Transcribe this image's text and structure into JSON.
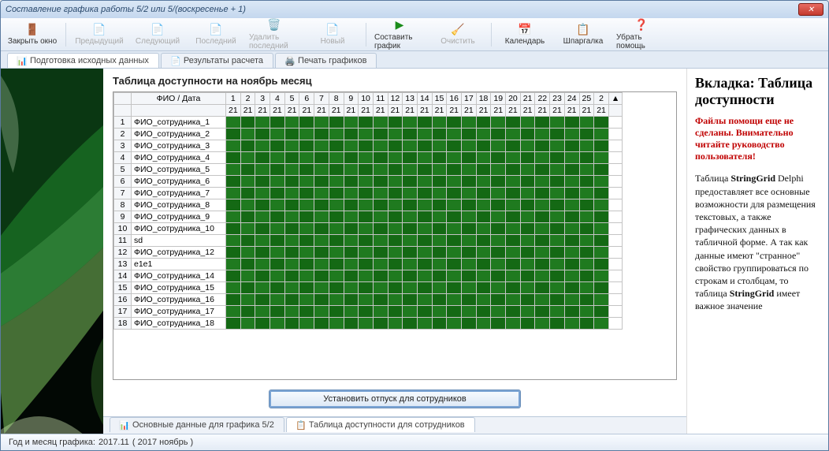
{
  "window": {
    "title": "Составление графика работы 5/2 или 5/(воскресенье + 1)"
  },
  "toolbar": {
    "close": "Закрыть окно",
    "prev": "Предыдущий",
    "next": "Следующий",
    "last": "Последний",
    "delLast": "Удалить последний",
    "new": "Новый",
    "compose": "Составить график",
    "clear": "Очистить",
    "calendar": "Календарь",
    "hint": "Шпаргалка",
    "hideHelp": "Убрать помощь"
  },
  "topTabs": {
    "prepare": "Подготовка исходных данных",
    "results": "Результаты расчета",
    "print": "Печать графиков"
  },
  "grid": {
    "title": "Таблица доступности на ноябрь месяц",
    "fioHeader": "ФИО / Дата",
    "days": [
      "1",
      "2",
      "3",
      "4",
      "5",
      "6",
      "7",
      "8",
      "9",
      "10",
      "11",
      "12",
      "13",
      "14",
      "15",
      "16",
      "17",
      "18",
      "19",
      "20",
      "21",
      "22",
      "23",
      "24",
      "25",
      "2"
    ],
    "fill": "21",
    "rows": [
      {
        "n": "1",
        "name": "ФИО_сотрудника_1"
      },
      {
        "n": "2",
        "name": "ФИО_сотрудника_2"
      },
      {
        "n": "3",
        "name": "ФИО_сотрудника_3"
      },
      {
        "n": "4",
        "name": "ФИО_сотрудника_4"
      },
      {
        "n": "5",
        "name": "ФИО_сотрудника_5"
      },
      {
        "n": "6",
        "name": "ФИО_сотрудника_6"
      },
      {
        "n": "7",
        "name": "ФИО_сотрудника_7"
      },
      {
        "n": "8",
        "name": "ФИО_сотрудника_8"
      },
      {
        "n": "9",
        "name": "ФИО_сотрудника_9"
      },
      {
        "n": "10",
        "name": "ФИО_сотрудника_10"
      },
      {
        "n": "11",
        "name": "sd"
      },
      {
        "n": "12",
        "name": "ФИО_сотрудника_12"
      },
      {
        "n": "13",
        "name": "e1e1"
      },
      {
        "n": "14",
        "name": "ФИО_сотрудника_14"
      },
      {
        "n": "15",
        "name": "ФИО_сотрудника_15"
      },
      {
        "n": "16",
        "name": "ФИО_сотрудника_16"
      },
      {
        "n": "17",
        "name": "ФИО_сотрудника_17"
      },
      {
        "n": "18",
        "name": "ФИО_сотрудника_18"
      }
    ]
  },
  "vacationBtn": "Установить отпуск для сотрудников",
  "bottomTabs": {
    "mainData": "Основные данные для графика 5/2",
    "availability": "Таблица доступности для сотрудников"
  },
  "help": {
    "heading": "Вкладка: Таблица доступности",
    "warn": "Файлы помощи еще не сделаны. Внимательно читайте руководство пользователя!",
    "body": "Таблица <b>StringGrid</b> Delphi предоставляет все основные возможности для размещения текстовых, а также графических данных в табличной форме. А так как данные имеют \"странное\" свойство группироваться по строкам и столбцам, то таблица <b>StringGrid</b> имеет важное значение"
  },
  "status": {
    "label": "Год и месяц графика:",
    "val": "2017.11",
    "extra": "( 2017  ноябрь )"
  }
}
